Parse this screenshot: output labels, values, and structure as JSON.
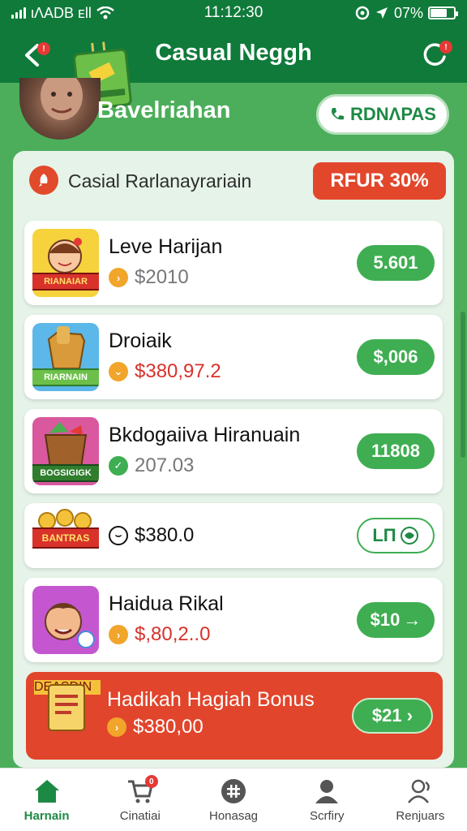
{
  "status_bar": {
    "left_text": "ιΛADB ᴇll",
    "time": "11:12:30",
    "right_text": "07%",
    "battery_level": 0.7
  },
  "app_bar": {
    "title": "Casual Neggh",
    "back_badge": "!",
    "refresh_badge": "!"
  },
  "profile": {
    "name": "Bavelriahan",
    "pill_label": "RDNΛPAS"
  },
  "panel": {
    "header_label": "Casial Rarlanayrariain",
    "promo_label": "RFUR 30%"
  },
  "items": [
    {
      "title": "Leve Harijan",
      "price": "$2010",
      "price_color": "#777777",
      "coin_color": "#f1a52b",
      "coin_glyph": "›",
      "action": "5.601",
      "thumb_label": "RIANAIAR"
    },
    {
      "title": "Droiaik",
      "price": "$380,97.2",
      "price_color": "#d8322b",
      "coin_color": "#f1a52b",
      "coin_glyph": "⌄",
      "action": "$,006",
      "thumb_label": "RIARNAIN"
    },
    {
      "title": "Bkdogaiiva Hiranuain",
      "price": "207.03",
      "price_color": "#777777",
      "coin_color": "#3fae52",
      "coin_glyph": "✓",
      "action": "11808",
      "thumb_label": "BOGSIGIGK"
    },
    {
      "title": "",
      "price": "$380.0",
      "price_color": "#111111",
      "coin_color": "#ffffff",
      "coin_glyph": "⌣",
      "action": "LΠ",
      "thumb_label": "BANTRAS"
    },
    {
      "title": "Haidua Rikal",
      "price": "$,80,2..0",
      "price_color": "#d8322b",
      "coin_color": "#f1a52b",
      "coin_glyph": "›",
      "action": "$10",
      "thumb_label": ""
    }
  ],
  "bonus": {
    "title": "Hadikah Hagiah Bonus",
    "price": "$380,00",
    "action": "$21",
    "thumb_label": "DEASDIN"
  },
  "bottom_nav": [
    {
      "label": "Harnain",
      "icon": "home-icon",
      "active": true
    },
    {
      "label": "Cinatiai",
      "icon": "cart-icon",
      "active": false,
      "badge": "0"
    },
    {
      "label": "Honasag",
      "icon": "grid-icon",
      "active": false
    },
    {
      "label": "Scrfiry",
      "icon": "person-icon",
      "active": false
    },
    {
      "label": "Renjuars",
      "icon": "people-icon",
      "active": false
    }
  ],
  "colors": {
    "primary_dark": "#0f7a3a",
    "primary": "#3fae52",
    "accent_red": "#e1452b",
    "background": "#4cae5a"
  }
}
